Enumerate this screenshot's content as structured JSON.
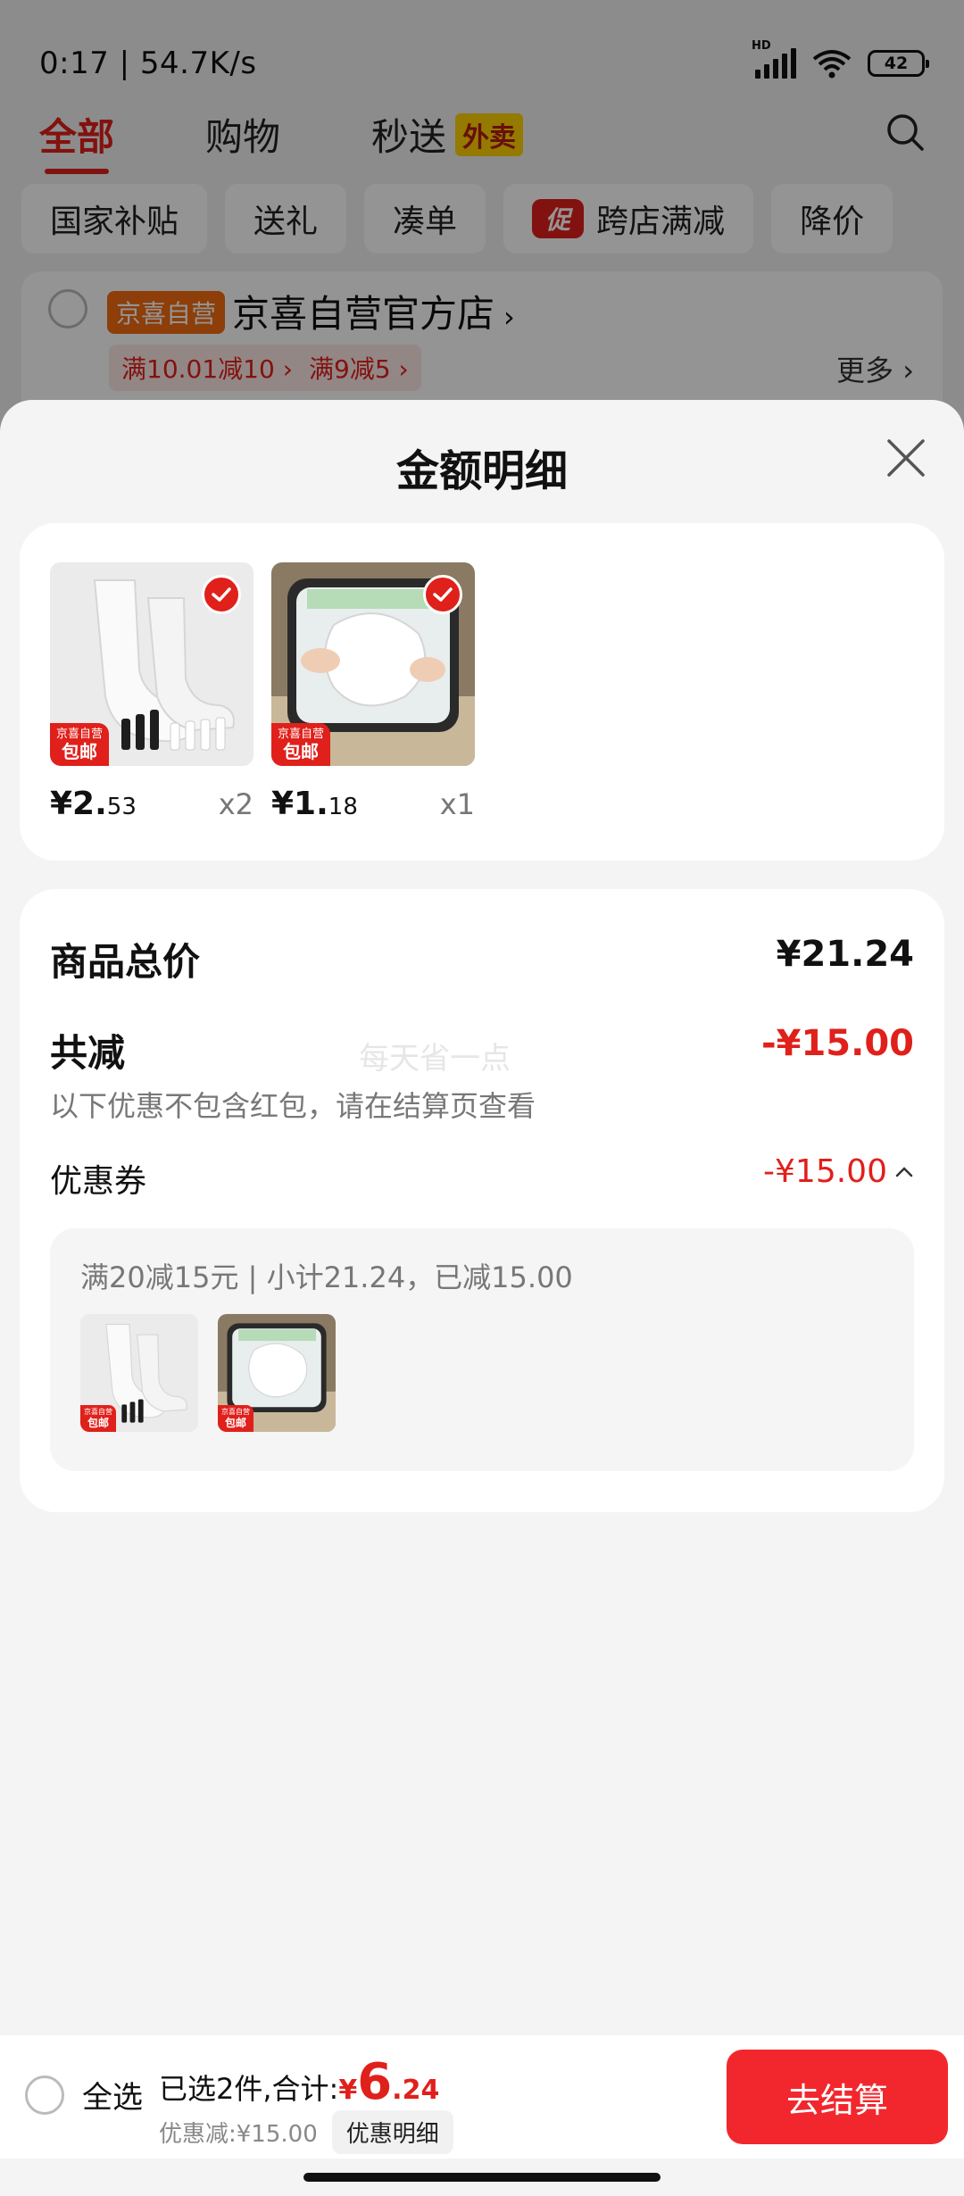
{
  "status_bar": {
    "time": "0:17 | 54.7K/s",
    "network_label": "HD",
    "battery": "42"
  },
  "top_tabs": [
    {
      "label": "全部",
      "active": true
    },
    {
      "label": "购物",
      "active": false
    },
    {
      "label": "秒送",
      "active": false,
      "badge": "外卖"
    }
  ],
  "filter_chips": [
    {
      "label": "国家补贴"
    },
    {
      "label": "送礼"
    },
    {
      "label": "凑单"
    },
    {
      "label": "跨店满减",
      "badge": "促"
    },
    {
      "label": "降价"
    }
  ],
  "store": {
    "tag": "京喜自营",
    "name": "京喜自营官方店",
    "name_arrow": "›",
    "promos": [
      "满10.01减10 ›",
      "满9减5 ›"
    ],
    "more": "更多 ›"
  },
  "sheet": {
    "title": "金额明细",
    "products": [
      {
        "name": "white-socks",
        "price_int": "¥2.",
        "price_dec": "53",
        "qty": "x2",
        "badge_line1": "京喜自营",
        "badge_line2": "包邮"
      },
      {
        "name": "underarm-pads",
        "price_int": "¥1.",
        "price_dec": "18",
        "qty": "x1",
        "badge_line1": "京喜自营",
        "badge_line2": "包邮"
      }
    ],
    "summary": {
      "total_label": "商品总价",
      "total_value": "¥21.24",
      "discount_label": "共减",
      "discount_value": "-¥15.00",
      "note": "以下优惠不包含红包，请在结算页查看",
      "watermark": "每天省一点",
      "coupon_label": "优惠券",
      "coupon_value": "-¥15.00",
      "coupon_desc": "满20减15元 | 小计21.24，已减15.00"
    }
  },
  "bottom_bar": {
    "select_all": "全选",
    "selected_prefix": "已选2件,合计:",
    "currency": "¥",
    "total_int": "6",
    "total_dec": ".24",
    "discount_text": "优惠减:¥15.00",
    "detail_button": "优惠明细",
    "checkout_button": "去结算"
  },
  "colors": {
    "accent": "#e0201b",
    "checkout": "#f2272d",
    "sheet_bg": "#f4f4f4"
  }
}
